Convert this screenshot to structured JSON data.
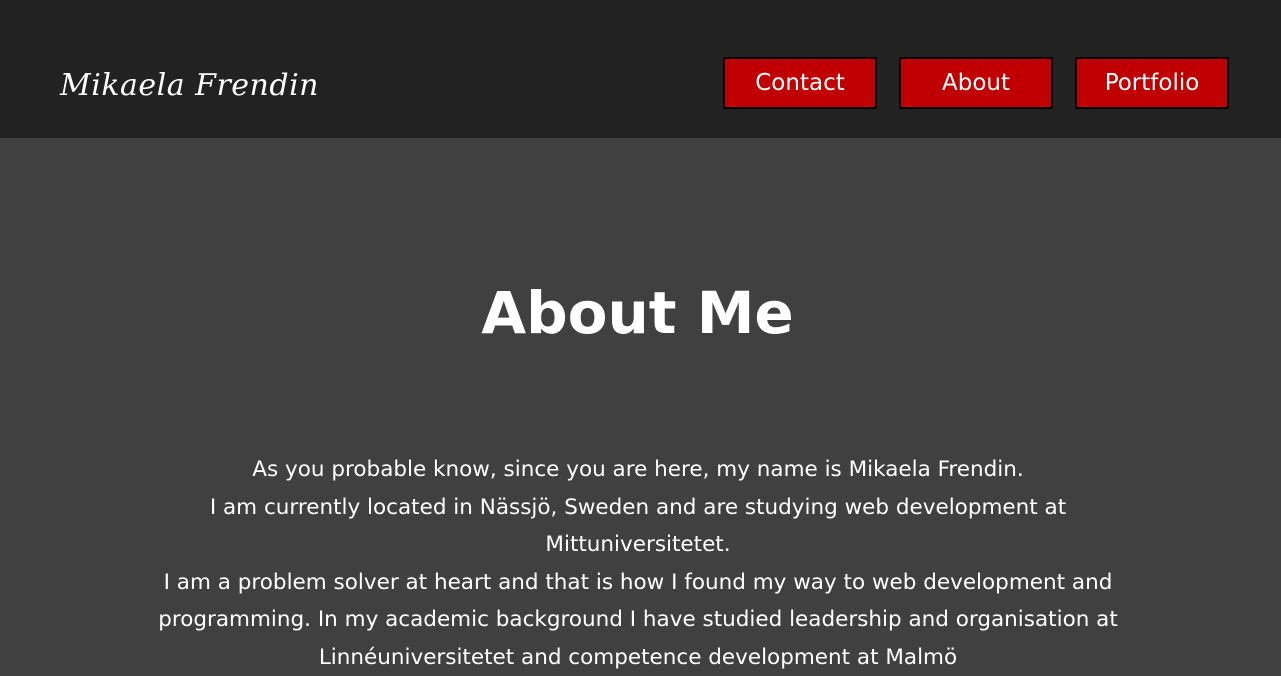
{
  "header": {
    "logo": "Mikaela  Frendin",
    "nav": [
      {
        "label": "Contact"
      },
      {
        "label": "About"
      },
      {
        "label": "Portfolio"
      }
    ]
  },
  "main": {
    "title": "About Me",
    "paragraphs": [
      "As you probable know, since you are here, my name is Mikaela Frendin.",
      "I am currently located in Nässjö, Sweden and are studying web development at Mittuniversitetet.",
      "I am a problem solver at heart and that is how I found my way to web development and programming. In my academic background I have studied leadership and organisation at Linnéuniversitetet and competence development at Malmö"
    ]
  },
  "colors": {
    "header_bg": "#222222",
    "page_bg": "#414041",
    "accent": "#c00000",
    "text": "#ffffff"
  }
}
